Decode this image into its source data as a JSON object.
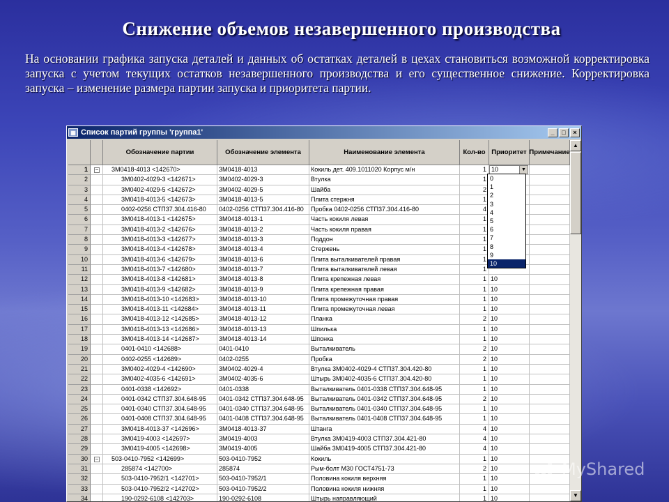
{
  "slide": {
    "title": "Снижение объемов незавершенного производства",
    "body": "На основании графика запуска деталей и данных об остатках деталей в цехах становиться возможной корректировка запуска с учетом текущих остатков незавершенного производства и его существенное снижение. Корректировка запуска – изменение размера партии запуска и приоритета партии."
  },
  "window": {
    "title": "Список партий группы 'группа1'",
    "minimize": "_",
    "maximize": "□",
    "close": "×"
  },
  "columns": {
    "batch": "Обозначение партии",
    "element": "Обозначение элемента",
    "name": "Наименование элемента",
    "qty": "Кол-во",
    "priority": "Приоритет",
    "note": "Примечание"
  },
  "rows": [
    {
      "n": "1",
      "exp": "−",
      "batch": "3М0418-4013 <142670>",
      "element": "3М0418-4013",
      "name": "Кокиль дет. 409.1011020 Корпус м/н",
      "qty": "1",
      "priority": "10"
    },
    {
      "n": "2",
      "batch": "3М0402-4029-3 <142671>",
      "element": "3М0402-4029-3",
      "name": "Втулка",
      "qty": "1",
      "priority": ""
    },
    {
      "n": "3",
      "batch": "3М0402-4029-5 <142672>",
      "element": "3М0402-4029-5",
      "name": "Шайба",
      "qty": "2",
      "priority": ""
    },
    {
      "n": "4",
      "batch": "3М0418-4013-5 <142673>",
      "element": "3М0418-4013-5",
      "name": "Плита стержня",
      "qty": "1",
      "priority": ""
    },
    {
      "n": "5",
      "batch": "0402-0256 СТП37.304.416-80",
      "element": "0402-0256 СТП37.304.416-80",
      "name": "Пробка 0402-0256 СТП37.304.416-80",
      "qty": "4",
      "priority": ""
    },
    {
      "n": "6",
      "batch": "3М0418-4013-1 <142675>",
      "element": "3М0418-4013-1",
      "name": "Часть кокиля левая",
      "qty": "1",
      "priority": ""
    },
    {
      "n": "7",
      "batch": "3М0418-4013-2 <142676>",
      "element": "3М0418-4013-2",
      "name": "Часть кокиля правая",
      "qty": "1",
      "priority": ""
    },
    {
      "n": "8",
      "batch": "3М0418-4013-3 <142677>",
      "element": "3М0418-4013-3",
      "name": "Поддон",
      "qty": "1",
      "priority": ""
    },
    {
      "n": "9",
      "batch": "3М0418-4013-4 <142678>",
      "element": "3М0418-4013-4",
      "name": "Стержень",
      "qty": "1",
      "priority": ""
    },
    {
      "n": "10",
      "batch": "3М0418-4013-6 <142679>",
      "element": "3М0418-4013-6",
      "name": "Плита выталкивателей правая",
      "qty": "1",
      "priority": ""
    },
    {
      "n": "11",
      "batch": "3М0418-4013-7 <142680>",
      "element": "3М0418-4013-7",
      "name": "Плита выталкивателей левая",
      "qty": "1",
      "priority": ""
    },
    {
      "n": "12",
      "batch": "3М0418-4013-8 <142681>",
      "element": "3М0418-4013-8",
      "name": "Плита крепежная левая",
      "qty": "1",
      "priority": "10"
    },
    {
      "n": "13",
      "batch": "3М0418-4013-9 <142682>",
      "element": "3М0418-4013-9",
      "name": "Плита крепежная правая",
      "qty": "1",
      "priority": "10"
    },
    {
      "n": "14",
      "batch": "3М0418-4013-10 <142683>",
      "element": "3М0418-4013-10",
      "name": "Плита промежуточная правая",
      "qty": "1",
      "priority": "10"
    },
    {
      "n": "15",
      "batch": "3М0418-4013-11 <142684>",
      "element": "3М0418-4013-11",
      "name": "Плита промежуточная левая",
      "qty": "1",
      "priority": "10"
    },
    {
      "n": "16",
      "batch": "3М0418-4013-12 <142685>",
      "element": "3М0418-4013-12",
      "name": "Планка",
      "qty": "2",
      "priority": "10"
    },
    {
      "n": "17",
      "batch": "3М0418-4013-13 <142686>",
      "element": "3М0418-4013-13",
      "name": "Шпилька",
      "qty": "1",
      "priority": "10"
    },
    {
      "n": "18",
      "batch": "3М0418-4013-14 <142687>",
      "element": "3М0418-4013-14",
      "name": "Шпонка",
      "qty": "1",
      "priority": "10"
    },
    {
      "n": "19",
      "batch": "0401-0410 <142688>",
      "element": "0401-0410",
      "name": "Выталкиватель",
      "qty": "2",
      "priority": "10"
    },
    {
      "n": "20",
      "batch": "0402-0255 <142689>",
      "element": "0402-0255",
      "name": "Пробка",
      "qty": "2",
      "priority": "10"
    },
    {
      "n": "21",
      "batch": "3М0402-4029-4 <142690>",
      "element": "3М0402-4029-4",
      "name": "Втулка 3М0402-4029-4 СТП37.304.420-80",
      "qty": "1",
      "priority": "10"
    },
    {
      "n": "22",
      "batch": "3М0402-4035-6 <142691>",
      "element": "3М0402-4035-6",
      "name": "Штырь 3М0402-4035-6 СТП37.304.420-80",
      "qty": "1",
      "priority": "10"
    },
    {
      "n": "23",
      "batch": "0401-0338 <142692>",
      "element": "0401-0338",
      "name": "Выталкиватель 0401-0338 СТП37.304.648-95",
      "qty": "1",
      "priority": "10"
    },
    {
      "n": "24",
      "batch": "0401-0342 СТП37.304.648-95",
      "element": "0401-0342 СТП37.304.648-95",
      "name": "Выталкиватель 0401-0342 СТП37.304.648-95",
      "qty": "2",
      "priority": "10"
    },
    {
      "n": "25",
      "batch": "0401-0340 СТП37.304.648-95",
      "element": "0401-0340 СТП37.304.648-95",
      "name": "Выталкиватель 0401-0340 СТП37.304.648-95",
      "qty": "1",
      "priority": "10"
    },
    {
      "n": "26",
      "batch": "0401-0408 СТП37.304.648-95",
      "element": "0401-0408 СТП37.304.648-95",
      "name": "Выталкиватель 0401-0408 СТП37.304.648-95",
      "qty": "1",
      "priority": "10"
    },
    {
      "n": "27",
      "batch": "3М0418-4013-37 <142696>",
      "element": "3М0418-4013-37",
      "name": "Штанга",
      "qty": "4",
      "priority": "10"
    },
    {
      "n": "28",
      "batch": "3М0419-4003 <142697>",
      "element": "3М0419-4003",
      "name": "Втулка 3М0419-4003 СТП37.304.421-80",
      "qty": "4",
      "priority": "10"
    },
    {
      "n": "29",
      "batch": "3М0419-4005 <142698>",
      "element": "3М0419-4005",
      "name": "Шайба 3М0419-4005 СТП37.304.421-80",
      "qty": "4",
      "priority": "10"
    },
    {
      "n": "30",
      "exp": "−",
      "batch": "503-0410-7952 <142699>",
      "element": "503-0410-7952",
      "name": "Кокиль",
      "qty": "1",
      "priority": "10"
    },
    {
      "n": "31",
      "batch": "285874 <142700>",
      "element": "285874",
      "name": "Рым-болт М30 ГОСТ4751-73",
      "qty": "2",
      "priority": "10"
    },
    {
      "n": "32",
      "batch": "503-0410-7952/1 <142701>",
      "element": "503-0410-7952/1",
      "name": "Половина кокиля верхняя",
      "qty": "1",
      "priority": "10"
    },
    {
      "n": "33",
      "batch": "503-0410-7952/2 <142702>",
      "element": "503-0410-7952/2",
      "name": "Половина кокиля нижняя",
      "qty": "1",
      "priority": "10"
    },
    {
      "n": "34",
      "batch": "190-0292-6108 <142703>",
      "element": "190-0292-6108",
      "name": "Штырь направляющий",
      "qty": "1",
      "priority": "10"
    }
  ],
  "dropdown": {
    "options": [
      "0",
      "1",
      "2",
      "3",
      "4",
      "5",
      "6",
      "7",
      "8",
      "9",
      "10"
    ],
    "selected": "10"
  },
  "watermark": "MyShared"
}
